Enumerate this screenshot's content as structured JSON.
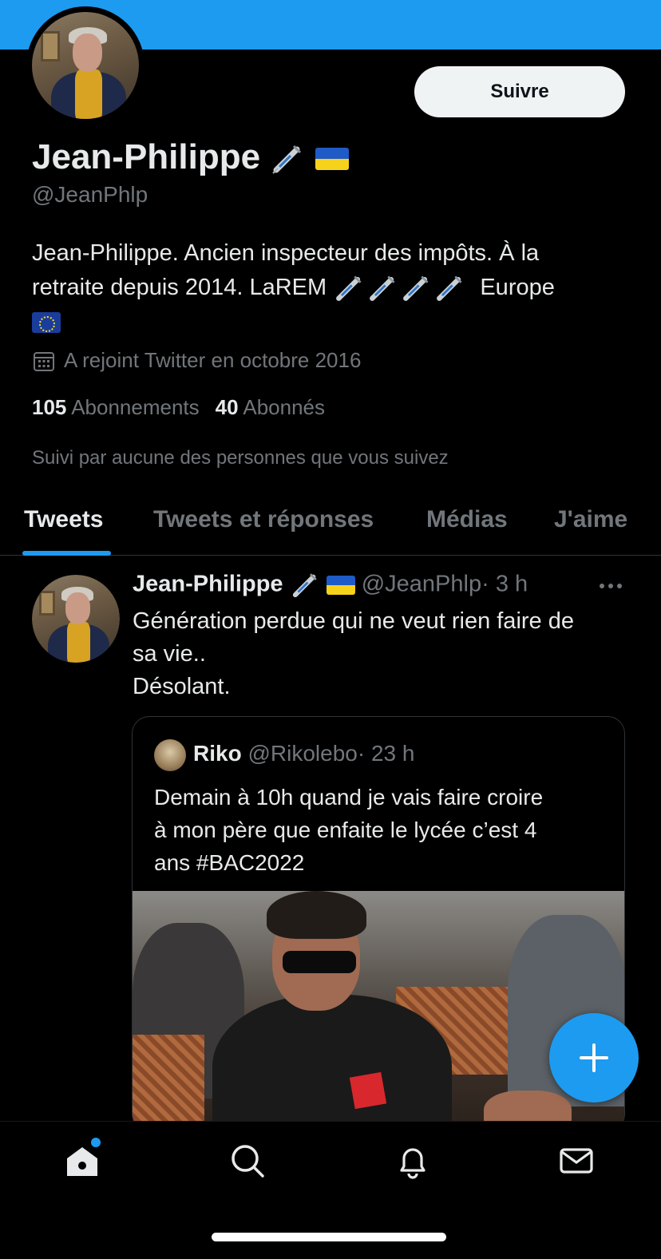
{
  "colors": {
    "accent": "#1d9bf0",
    "background": "#000000",
    "text": "#e7e9ea",
    "muted": "#71767b"
  },
  "profile": {
    "name": "Jean-Philippe",
    "handle": "@JeanPhlp",
    "follow_label": "Suivre",
    "bio_line1": "Jean-Philippe. Ancien inspecteur des impôts. À la",
    "bio_line2": "retraite depuis 2014. LaREM",
    "bio_suffix": "Europe",
    "joined": "A rejoint Twitter en octobre 2016",
    "following_count": "105",
    "following_label": "Abonnements",
    "followers_count": "40",
    "followers_label": "Abonnés",
    "followed_by": "Suivi par aucune des personnes que vous suivez",
    "name_emojis": [
      "syringe-icon",
      "ukraine-flag-icon"
    ],
    "bio_emojis": [
      "syringe-icon",
      "syringe-icon",
      "syringe-icon",
      "syringe-icon",
      "eu-flag-icon"
    ]
  },
  "tabs": [
    {
      "label": "Tweets",
      "active": true
    },
    {
      "label": "Tweets et réponses",
      "active": false
    },
    {
      "label": "Médias",
      "active": false
    },
    {
      "label": "J'aime",
      "active": false
    }
  ],
  "tweet": {
    "author": "Jean-Philippe",
    "handle": "@JeanPhlp",
    "time": "· 3 h",
    "line1": "Génération perdue qui ne veut rien faire de",
    "line2": "sa vie..",
    "line3": "Désolant.",
    "quote": {
      "author": "Riko",
      "handle": "@Rikolebo",
      "time": "· 23 h",
      "line1": "Demain à 10h quand je vais faire croire",
      "line2": "à mon père que enfaite le lycée c’est 4",
      "line3": "ans #BAC2022"
    }
  },
  "bottom_nav": [
    "home-icon",
    "search-icon",
    "notifications-icon",
    "messages-icon"
  ]
}
